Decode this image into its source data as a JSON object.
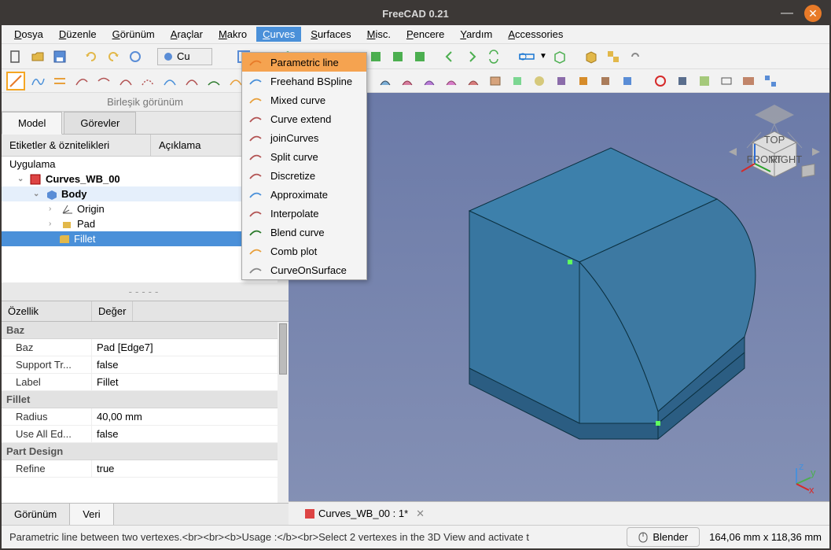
{
  "window": {
    "title": "FreeCAD 0.21"
  },
  "menubar": [
    {
      "label": "Dosya",
      "u": "D"
    },
    {
      "label": "Düzenle",
      "u": "D"
    },
    {
      "label": "Görünüm",
      "u": "G"
    },
    {
      "label": "Araçlar",
      "u": "A"
    },
    {
      "label": "Makro",
      "u": "M"
    },
    {
      "label": "Curves",
      "u": "C",
      "active": true
    },
    {
      "label": "Surfaces",
      "u": "S"
    },
    {
      "label": "Misc.",
      "u": "M"
    },
    {
      "label": "Pencere",
      "u": "P"
    },
    {
      "label": "Yardım",
      "u": "Y"
    },
    {
      "label": "Accessories",
      "u": "A"
    }
  ],
  "dropdown": [
    {
      "label": "Parametric line",
      "hl": true,
      "color": "#e87a28"
    },
    {
      "label": "Freehand BSpline",
      "color": "#4a90d9"
    },
    {
      "label": "Mixed curve",
      "color": "#e8a03c"
    },
    {
      "label": "Curve extend",
      "color": "#b35454"
    },
    {
      "label": "joinCurves",
      "color": "#b35454"
    },
    {
      "label": "Split curve",
      "color": "#b35454"
    },
    {
      "label": "Discretize",
      "color": "#b35454"
    },
    {
      "label": "Approximate",
      "color": "#4a90d9"
    },
    {
      "label": "Interpolate",
      "color": "#b35454"
    },
    {
      "label": "Blend curve",
      "color": "#2b7a2b"
    },
    {
      "label": "Comb plot",
      "color": "#e8a03c"
    },
    {
      "label": "CurveOnSurface",
      "color": "#888"
    }
  ],
  "wb_selector": "Cu",
  "combo": {
    "title": "Birleşik görünüm",
    "tabs": [
      "Model",
      "Görevler"
    ],
    "activeTab": 0,
    "treeHeaders": [
      "Etiketler & öznitelikleri",
      "Açıklama"
    ],
    "root": "Uygulama",
    "nodes": {
      "doc": "Curves_WB_00",
      "body": "Body",
      "origin": "Origin",
      "pad": "Pad",
      "fillet": "Fillet"
    }
  },
  "props": {
    "headers": [
      "Özellik",
      "Değer"
    ],
    "Baz": [
      {
        "k": "Baz",
        "v": "Pad [Edge7]"
      },
      {
        "k": "Support Tr...",
        "v": "false"
      },
      {
        "k": "Label",
        "v": "Fillet"
      }
    ],
    "Fillet": [
      {
        "k": "Radius",
        "v": "40,00 mm"
      },
      {
        "k": "Use All Ed...",
        "v": "false"
      }
    ],
    "PartDesign": [
      {
        "k": "Refine",
        "v": "true"
      }
    ],
    "bottomTabs": [
      "Görünüm",
      "Veri"
    ],
    "activeBot": 1
  },
  "doctab": "Curves_WB_00 : 1*",
  "status": {
    "hint": "Parametric line between two vertexes.<br><br><b>Usage :</b><br>Select 2 vertexes in the 3D View and activate t",
    "button": "Blender",
    "coords": "164,06 mm x 118,36 mm"
  }
}
